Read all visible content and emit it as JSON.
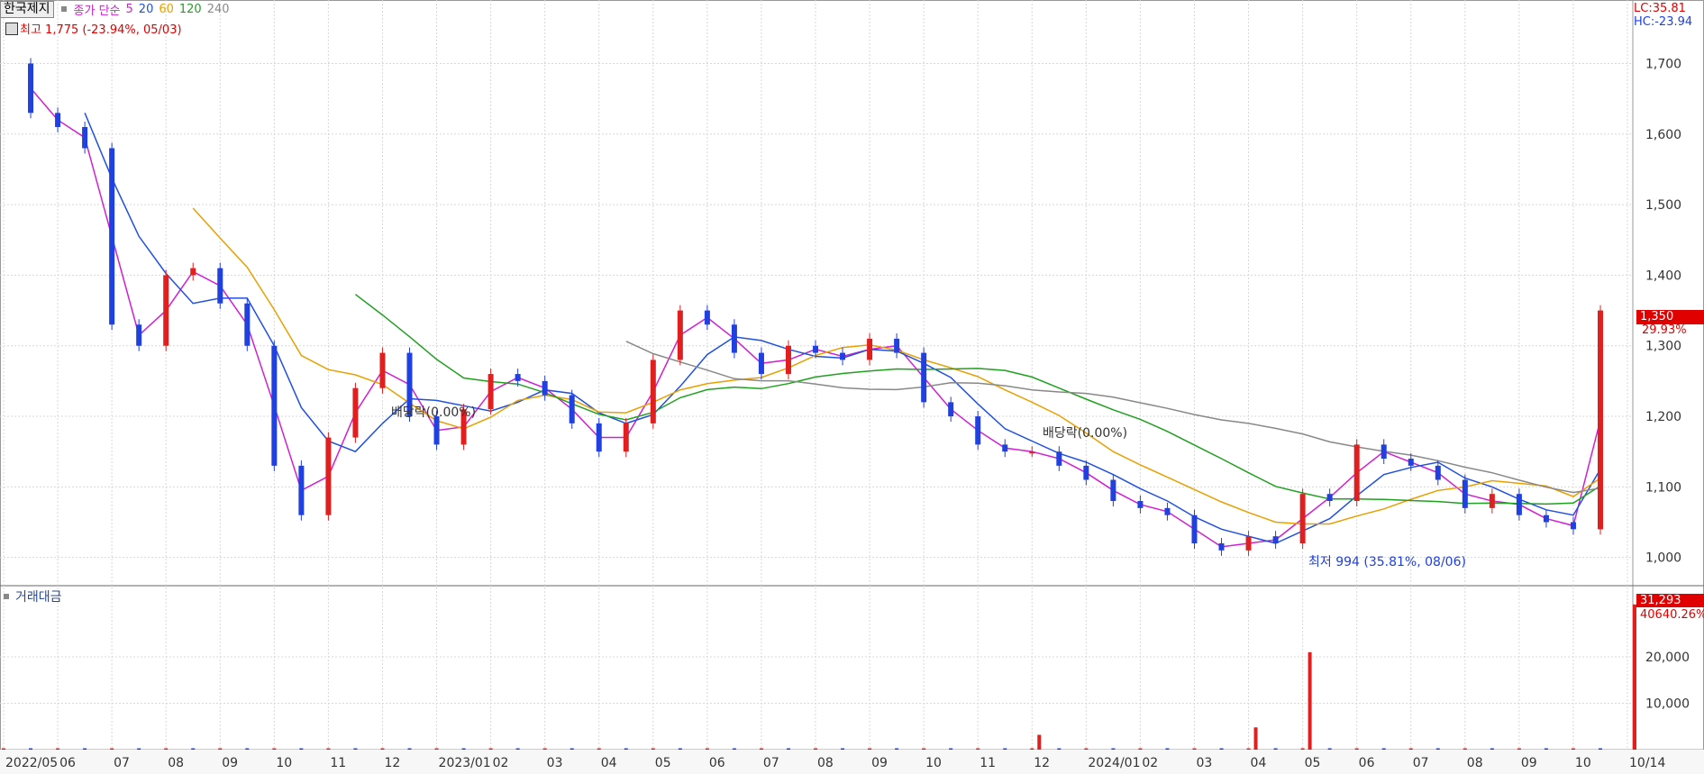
{
  "header": {
    "stock_name": "한국제지",
    "ma_label": "종가 단순",
    "ma_periods": [
      "5",
      "20",
      "60",
      "120",
      "240"
    ],
    "ma_colors": [
      "#d020d0",
      "#2050e0",
      "#e8a000",
      "#20a020",
      "#888888"
    ],
    "high_note": "최고 1,775 (-23.94%, 05/03)",
    "lc_text": "LC:35.81",
    "hc_text": "HC:-23.94"
  },
  "volume_panel": {
    "title": "거래대금",
    "last_value_label": "31,293",
    "last_sub_label": "40640.26%"
  },
  "price_tag": {
    "value": "1,350",
    "pct": "29.93%"
  },
  "annotations": {
    "dividend_1": "배당락(0.00%)",
    "dividend_2": "배당락(0.00%)",
    "low_note": "최저 994 (35.81%, 08/06)"
  },
  "colors": {
    "up": "#e02020",
    "down": "#2040e0",
    "grid": "#d8d8d8",
    "axis_bg": "#ffffff"
  },
  "chart_data": {
    "type": "line",
    "price": {
      "ylim": [
        960,
        1790
      ],
      "y_ticks": [
        "1,000",
        "1,100",
        "1,200",
        "1,300",
        "1,400",
        "1,500",
        "1,600",
        "1,700"
      ],
      "y_tick_values": [
        1000,
        1100,
        1200,
        1300,
        1400,
        1500,
        1600,
        1700
      ],
      "x_ticks": [
        "2022/05",
        "06",
        "07",
        "08",
        "09",
        "10",
        "11",
        "12",
        "2023/01",
        "02",
        "03",
        "04",
        "05",
        "06",
        "07",
        "08",
        "09",
        "10",
        "11",
        "12",
        "2024/01",
        "02",
        "03",
        "04",
        "05",
        "06",
        "07",
        "08",
        "09",
        "10",
        "10/14"
      ],
      "close_series": [
        [
          "2022/05",
          1700
        ],
        [
          "2022/05",
          1630
        ],
        [
          "06",
          1610
        ],
        [
          "06",
          1580
        ],
        [
          "07",
          1330
        ],
        [
          "07",
          1300
        ],
        [
          "08",
          1400
        ],
        [
          "08",
          1410
        ],
        [
          "09",
          1360
        ],
        [
          "09",
          1300
        ],
        [
          "10",
          1130
        ],
        [
          "10",
          1060
        ],
        [
          "11",
          1170
        ],
        [
          "11",
          1240
        ],
        [
          "12",
          1290
        ],
        [
          "12",
          1200
        ],
        [
          "2023/01",
          1160
        ],
        [
          "2023/01",
          1210
        ],
        [
          "02",
          1260
        ],
        [
          "02",
          1250
        ],
        [
          "03",
          1230
        ],
        [
          "03",
          1190
        ],
        [
          "04",
          1150
        ],
        [
          "04",
          1190
        ],
        [
          "05",
          1280
        ],
        [
          "05",
          1350
        ],
        [
          "06",
          1330
        ],
        [
          "06",
          1290
        ],
        [
          "07",
          1260
        ],
        [
          "07",
          1300
        ],
        [
          "08",
          1290
        ],
        [
          "08",
          1280
        ],
        [
          "09",
          1310
        ],
        [
          "09",
          1290
        ],
        [
          "10",
          1220
        ],
        [
          "10",
          1200
        ],
        [
          "11",
          1160
        ],
        [
          "11",
          1150
        ],
        [
          "12",
          1150
        ],
        [
          "12",
          1130
        ],
        [
          "2024/01",
          1110
        ],
        [
          "2024/01",
          1080
        ],
        [
          "02",
          1070
        ],
        [
          "02",
          1060
        ],
        [
          "03",
          1020
        ],
        [
          "03",
          1010
        ],
        [
          "04",
          1030
        ],
        [
          "04",
          1020
        ],
        [
          "05",
          1090
        ],
        [
          "05",
          1080
        ],
        [
          "06",
          1160
        ],
        [
          "06",
          1140
        ],
        [
          "07",
          1130
        ],
        [
          "07",
          1110
        ],
        [
          "08",
          1070
        ],
        [
          "08",
          1090
        ],
        [
          "09",
          1060
        ],
        [
          "09",
          1050
        ],
        [
          "10",
          1040
        ],
        [
          "10/14",
          1350
        ]
      ],
      "last_price": 1350,
      "high": 1775,
      "low": 994
    },
    "volume": {
      "y_ticks": [
        "10,000",
        "20,000"
      ],
      "y_tick_values": [
        10000,
        20000
      ],
      "ylim": [
        0,
        33000
      ],
      "spikes": [
        [
          "12",
          3200
        ],
        [
          "05",
          21000
        ],
        [
          "04",
          4800
        ],
        [
          "10/14",
          31293
        ]
      ]
    }
  }
}
